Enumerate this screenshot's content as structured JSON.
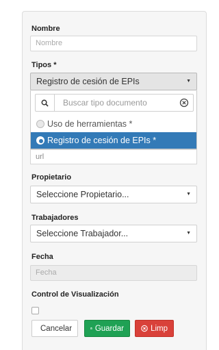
{
  "form": {
    "nombre": {
      "label": "Nombre",
      "placeholder": "Nombre"
    },
    "tipos": {
      "label": "Tipos *",
      "selected": "Registro de cesión de EPIs",
      "search_placeholder": "Buscar tipo documento",
      "options": [
        {
          "label": "Uso de herramientas *",
          "state": "disabled"
        },
        {
          "label": "Registro de cesión de EPIs *",
          "state": "highlighted"
        }
      ]
    },
    "url": {
      "placeholder": "url"
    },
    "propietario": {
      "label": "Propietario",
      "selected": "Seleccione Propietario..."
    },
    "trabajadores": {
      "label": "Trabajadores",
      "selected": "Seleccione Trabajador..."
    },
    "fecha": {
      "label": "Fecha",
      "placeholder": "Fecha"
    },
    "control": {
      "label": "Control de Visualización",
      "checked": false
    }
  },
  "actions": {
    "cancel": "Cancelar",
    "save": "Guardar",
    "clear": "Limp"
  },
  "colors": {
    "primary": "#337ab7",
    "success": "#1fa154",
    "danger": "#d9413a"
  }
}
